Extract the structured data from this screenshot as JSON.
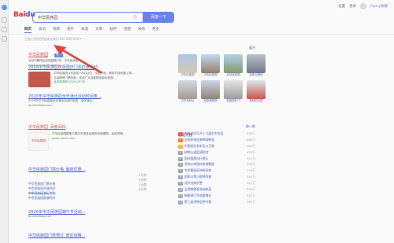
{
  "header": {
    "logo_left": "Bai",
    "logo_mid": "du",
    "logo_right": "百度",
    "search_value": "中华民族园",
    "search_button": "百度一下",
    "right_links": [
      "设置",
      "登录",
      "设置·天气"
    ],
    "user_name": "Fancy收藏"
  },
  "tabs": [
    "网页",
    "资讯",
    "视频",
    "图片",
    "知道",
    "文库",
    "贴吧",
    "地图",
    "采购",
    "更多"
  ],
  "result_count": "百度为您找到相关结果约100,000,000个",
  "results": [
    {
      "title": "中华民族园",
      "badge": "官方",
      "text": "北京市朝阳区民族园路1号，中华民族园",
      "src": "www.emuseum.org.cn"
    },
    {
      "title": "2020中华民族园庆祝国庆门票优惠活动",
      "text": "中华民族园今日起至10月10日，全园开放，精彩节目轮番上演…",
      "text2": "活动期间门票优惠，欢迎广大游客前来游玩参观…",
      "src": "北京旅游网 2020-09-28"
    },
    {
      "title": "2020年中华民族园全年演出活动时间表...",
      "text": "2020年中华民族园全年演出活动时间表，全年演出…",
      "src": "bj.bendibao.com"
    },
    {
      "title": "中华民族园_百度百科",
      "text": "中华民族园是集中展示中国各民族的传统建筑、民俗风情…",
      "src": "baike.baidu.com"
    },
    {
      "title": "中华民族园门票价格_最新优惠...",
      "src": "www.tuniu.com"
    },
    {
      "title": "2020年中华民族园端午节活动...",
      "src": "bj.bendibao.com"
    },
    {
      "title": "中华民族园门票预订_景区攻略..."
    }
  ],
  "baike_thumb_text": "中华民族园",
  "sub_links": [
    {
      "text": "中华民族园门票价格",
      "date": "5天前"
    },
    {
      "text": "中华民族园开放时间",
      "date": "6天前"
    },
    {
      "text": "中华民族园游玩攻略",
      "date": "7天前"
    },
    {
      "text": "中华民族园表演时间",
      "date": "8天前"
    }
  ],
  "right": {
    "section_title": "相关景点",
    "more": "展开",
    "tiles": [
      "中华民族园",
      "中华民族园",
      "北京民族园",
      "民族大团结",
      "中华世纪坛",
      "民族博物馆",
      "民族园东门",
      "奥林匹克园"
    ],
    "hot_title": "百度热搜",
    "hot_more": "换一换",
    "hot": [
      {
        "rank": "1",
        "text": "中央决定召开十九届五中全会",
        "value": "498万"
      },
      {
        "rank": "2",
        "text": "全国多地迎来降雨降温",
        "value": "486万"
      },
      {
        "rank": "3",
        "text": "中国成功发射北斗卫星",
        "value": "462万"
      },
      {
        "rank": "4",
        "text": "钟南山谈疫情防控",
        "value": "433万"
      },
      {
        "rank": "5",
        "text": "国庆假期出行提示",
        "value": "411万"
      },
      {
        "rank": "6",
        "text": "多地公布国庆旅游数据",
        "value": "398万"
      },
      {
        "rank": "7",
        "text": "专家解读经济新形势",
        "value": "376万"
      },
      {
        "rank": "8",
        "text": "国家公祭日即将到来",
        "value": "345万"
      },
      {
        "rank": "9",
        "text": "北京迎来初雪",
        "value": "321万"
      },
      {
        "rank": "10",
        "text": "全国铁路客流创新高",
        "value": "306万"
      },
      {
        "rank": "11",
        "text": "新能源汽车销量增长",
        "value": "287万"
      },
      {
        "rank": "12",
        "text": "第三届进博会将开幕",
        "value": "265万"
      }
    ]
  },
  "colors": {
    "accent": "#4e6ef2",
    "link": "#2440b3",
    "red": "#e10602"
  }
}
